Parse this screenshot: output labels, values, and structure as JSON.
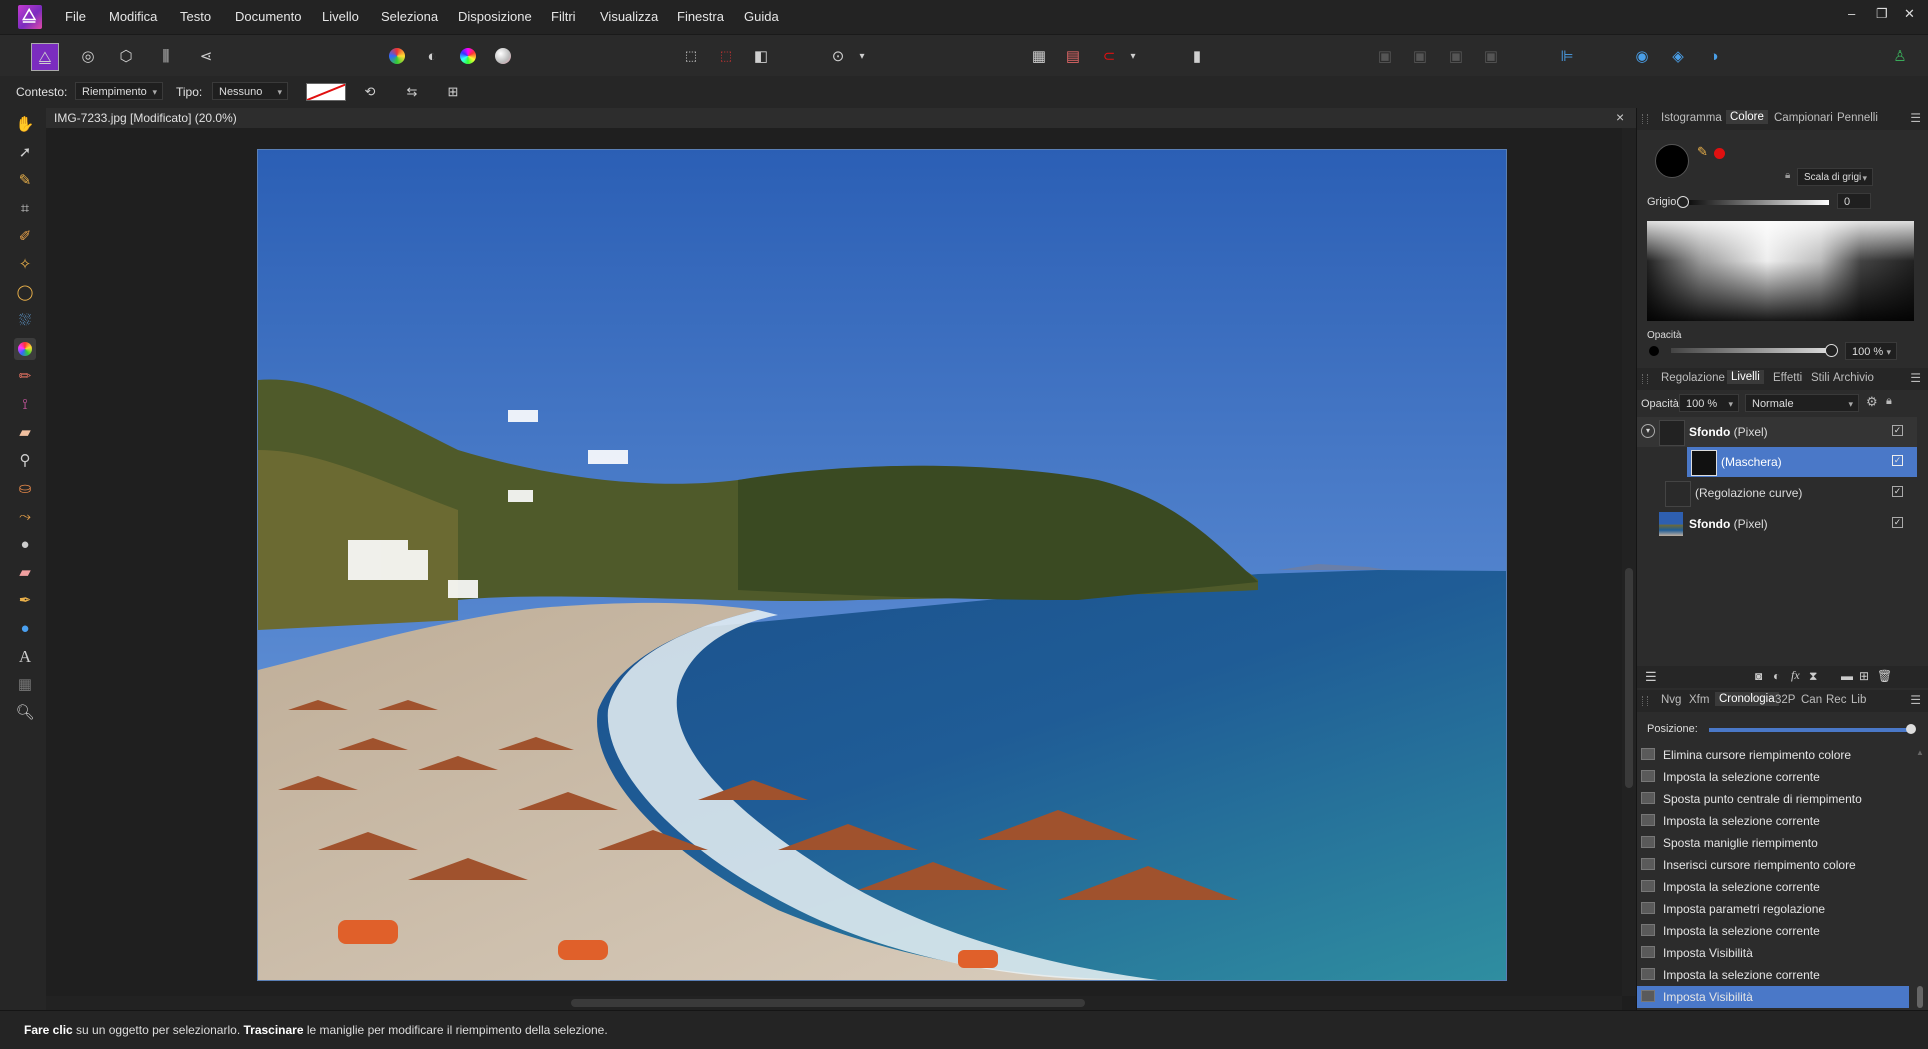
{
  "menubar": {
    "items": [
      "File",
      "Modifica",
      "Testo",
      "Documento",
      "Livello",
      "Seleziona",
      "Disposizione",
      "Filtri",
      "Visualizza",
      "Finestra",
      "Guida"
    ],
    "window_min": "–",
    "window_restore": "❐",
    "window_close": "✕"
  },
  "context_toolbar": {
    "contesto_label": "Contesto:",
    "contesto_value": "Riempimento",
    "tipo_label": "Tipo:",
    "tipo_value": "Nessuno"
  },
  "document": {
    "tab_title": "IMG-7233.jpg [Modificato] (20.0%)",
    "close": "×"
  },
  "color_panel": {
    "tabs": [
      "Istogramma",
      "Colore",
      "Campionari",
      "Pennelli"
    ],
    "selected_tab": "Colore",
    "mode": "Scala di grigi",
    "grey_label": "Grigio:",
    "grey_value": "0",
    "opacity_label": "Opacità",
    "opacity_value": "100 %"
  },
  "layers_panel": {
    "tabs": [
      "Regolazione",
      "Livelli",
      "Effetti",
      "Stili",
      "Archivio"
    ],
    "selected_tab": "Livelli",
    "opacity_label": "Opacità:",
    "opacity_value": "100 %",
    "blend_mode": "Normale",
    "layers": [
      {
        "name": "Sfondo",
        "kind": "(Pixel)"
      },
      {
        "name": "",
        "kind": "(Maschera)"
      },
      {
        "name": "",
        "kind": "(Regolazione curve)"
      },
      {
        "name": "Sfondo",
        "kind": "(Pixel)"
      }
    ]
  },
  "history_panel": {
    "tabs": [
      "Nvg",
      "Xfm",
      "Cronologia",
      "32P",
      "Can",
      "Rec",
      "Lib"
    ],
    "selected_tab": "Cronologia",
    "position_label": "Posizione:",
    "position_value": 1.0,
    "items": [
      "Elimina cursore riempimento colore",
      "Imposta la selezione corrente",
      "Sposta punto centrale di riempimento",
      "Imposta la selezione corrente",
      "Sposta maniglie riempimento",
      "Inserisci cursore riempimento colore",
      "Imposta la selezione corrente",
      "Imposta parametri regolazione",
      "Imposta la selezione corrente",
      "Imposta Visibilità",
      "Imposta la selezione corrente",
      "Imposta Visibilità"
    ]
  },
  "status": {
    "bold1": "Fare clic",
    "text1": " su un oggetto per selezionarlo. ",
    "bold2": "Trascinare",
    "text2": " le maniglie per modificare il riempimento della selezione."
  },
  "colors": {
    "accent": "#4a78c8",
    "active_red": "#e01010"
  }
}
